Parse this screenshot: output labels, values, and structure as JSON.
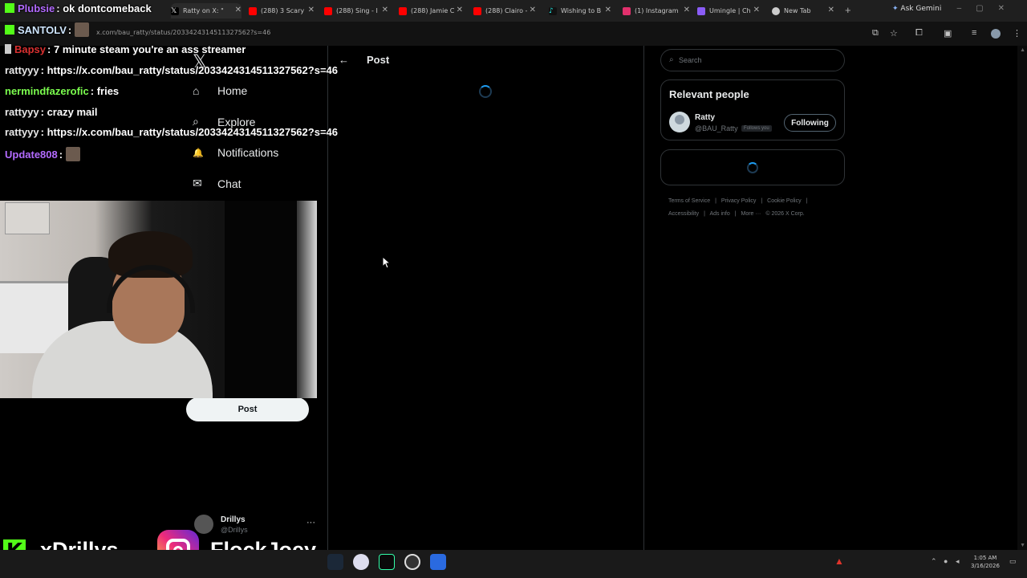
{
  "browser": {
    "tabs": [
      {
        "title": "Ratty on X: \"",
        "fav_color": "#ffffff"
      },
      {
        "title": "(288) 3 Scary",
        "fav_color": "#ff0000"
      },
      {
        "title": "(288) Sing - I",
        "fav_color": "#ff0000"
      },
      {
        "title": "(288) Jamie C",
        "fav_color": "#ff0000"
      },
      {
        "title": "(288) Clairo -",
        "fav_color": "#ff0000"
      },
      {
        "title": "Wishing to B",
        "fav_color": "#25f4ee"
      },
      {
        "title": "(1) Instagram",
        "fav_color": "#e1306c"
      },
      {
        "title": "Umingle | Ch",
        "fav_color": "#8a5cf6"
      },
      {
        "title": "New Tab",
        "fav_color": "#cccccc"
      }
    ],
    "gemini_label": "Ask Gemini",
    "url": "x.com/bau_ratty/status/2033424314511327562?s=46"
  },
  "x": {
    "logo": "𝕏",
    "nav": [
      {
        "label": "Home",
        "icon": "⌂"
      },
      {
        "label": "Explore",
        "icon": "⌕"
      },
      {
        "label": "Notifications",
        "icon": "🔔"
      },
      {
        "label": "Chat",
        "icon": "✉"
      }
    ],
    "post_button": "Post",
    "account": {
      "name": "Drillys",
      "handle": "@Drillys",
      "more": "···"
    },
    "main": {
      "back": "←",
      "title": "Post"
    },
    "search": {
      "placeholder": "Search",
      "icon": "⌕"
    },
    "relevant": {
      "heading": "Relevant people",
      "name": "Ratty",
      "handle": "@BAU_Ratty",
      "follows_you": "Follows you",
      "button": "Following"
    },
    "footer": [
      "Terms of Service",
      "|",
      "Privacy Policy",
      "|",
      "Cookie Policy",
      "|",
      "Accessibility",
      "|",
      "Ads info",
      "|",
      "More ···",
      "© 2026 X Corp."
    ]
  },
  "chat": [
    {
      "user": "Plubsie",
      "msg": ": ok dontcomeback",
      "color": "#b36bff"
    },
    {
      "user": "SANTOLV",
      "msg": ":",
      "color": "#cfe6ff"
    },
    {
      "user": "Bapsy",
      "msg": ": 7 minute steam you're an ass streamer",
      "color": "#d93030"
    },
    {
      "user": "rattyyy",
      "msg": ": https://x.com/bau_ratty/status/2033424314511327562?s=46",
      "color": "#e8e8e8"
    },
    {
      "user": "nermindfazerofic",
      "msg": ": fries",
      "color": "#7cff4f"
    },
    {
      "user": "rattyyy",
      "msg": ": crazy mail",
      "color": "#e8e8e8"
    },
    {
      "user": "rattyyy",
      "msg": ": https://x.com/bau_ratty/status/2033424314511327562?s=46",
      "color": "#e8e8e8"
    },
    {
      "user": "Update808",
      "msg": ":",
      "color": "#b36bff"
    }
  ],
  "banner": {
    "kick_icon": "K",
    "kick_name": "xDrillys",
    "ig_name": "FlockJoey"
  },
  "taskbar": {
    "clock_time": "1:05 AM",
    "clock_date": "3/16/2026"
  }
}
